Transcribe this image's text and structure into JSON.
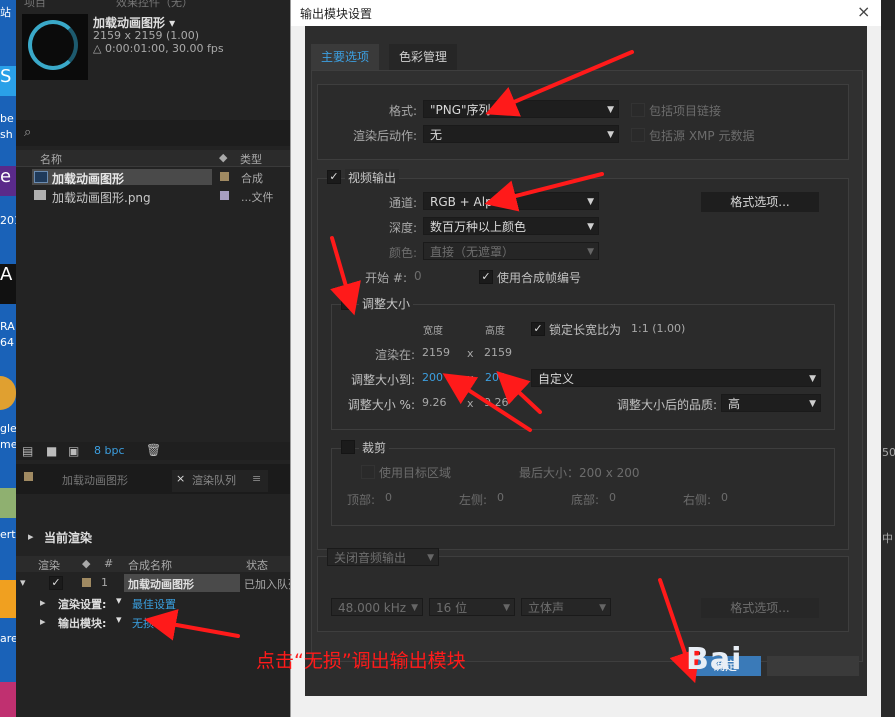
{
  "desktop": {
    "left_strip_texts": [
      "站",
      "S",
      "be",
      "sh",
      "e",
      "201",
      "A",
      "RA",
      "64",
      "gle",
      "me",
      "ert",
      "are"
    ]
  },
  "project_panel": {
    "tab_labels": [
      "项目",
      "效果控件（无）"
    ],
    "comp_title": "加载动画图形 ▾",
    "comp_size": "2159 x 2159 (1.00)",
    "comp_duration": "△ 0:00:01:00, 30.00 fps",
    "search_icon": "search-icon",
    "columns": {
      "name": "名称",
      "type": "类型"
    },
    "items": [
      {
        "name": "加载动画图形",
        "type": "合成"
      },
      {
        "name": "加载动画图形.png",
        "type": "...文件"
      }
    ],
    "footer_bpc": "8 bpc"
  },
  "render_queue": {
    "tab_comp": "加载动画图形",
    "tab_queue": "渲染队列",
    "section_title": "当前渲染",
    "columns": {
      "render": "渲染",
      "num": "#",
      "comp_name": "合成名称",
      "status": "状态"
    },
    "row": {
      "num": "1",
      "comp_name": "加载动画图形",
      "status": "已加入队列"
    },
    "render_settings_label": "渲染设置:",
    "render_settings_value": "最佳设置",
    "output_module_label": "输出模块:",
    "output_module_value": "无损"
  },
  "right_edge_texts": [
    "50",
    "中"
  ],
  "dialog": {
    "title": "输出模块设置",
    "close_label": "×",
    "tabs": [
      "主要选项",
      "色彩管理"
    ],
    "format_label": "格式:",
    "format_value": "\"PNG\"序列",
    "post_render_label": "渲染后动作:",
    "post_render_value": "无",
    "include_project_link": "包括项目链接",
    "include_xmp": "包括源 XMP 元数据",
    "video_output_label": "视频输出",
    "channels_label": "通道:",
    "channels_value": "RGB + Alpha",
    "format_options_button": "格式选项...",
    "depth_label": "深度:",
    "depth_value": "数百万种以上颜色",
    "color_label": "颜色:",
    "color_value": "直接（无遮罩）",
    "start_label": "开始 #:",
    "start_value": "0",
    "use_comp_frame": "使用合成帧编号",
    "resize_label": "调整大小",
    "width_header": "宽度",
    "height_header": "高度",
    "lock_aspect": "锁定长宽比为",
    "lock_aspect_ratio": "1:1 (1.00)",
    "rendering_at_label": "渲染在:",
    "rendering_w": "2159",
    "rendering_h": "2159",
    "resize_to_label": "调整大小到:",
    "resize_w": "200",
    "resize_h": "200",
    "resize_preset": "自定义",
    "resize_pct_label": "调整大小 %:",
    "resize_pct_w": "9.26",
    "resize_pct_h": "9.26",
    "quality_label": "调整大小后的品质:",
    "quality_value": "高",
    "x_sep": "x",
    "crop_label": "裁剪",
    "use_roi": "使用目标区域",
    "final_size": "最后大小：200 x 200",
    "top_label": "顶部:",
    "top_value": "0",
    "left_label": "左侧:",
    "left_value": "0",
    "bottom_label": "底部:",
    "bottom_value": "0",
    "right_label": "右侧:",
    "right_value": "0",
    "audio_output": "关闭音频输出",
    "sample_rate": "48.000 kHz",
    "bit_depth": "16 位",
    "channels_audio": "立体声",
    "audio_format_options": "格式选项...",
    "ok_label": "确定"
  },
  "annotation": {
    "text": "点击“无损”调出输出模块",
    "color": "#ff1a1a"
  },
  "watermark": "Bai"
}
